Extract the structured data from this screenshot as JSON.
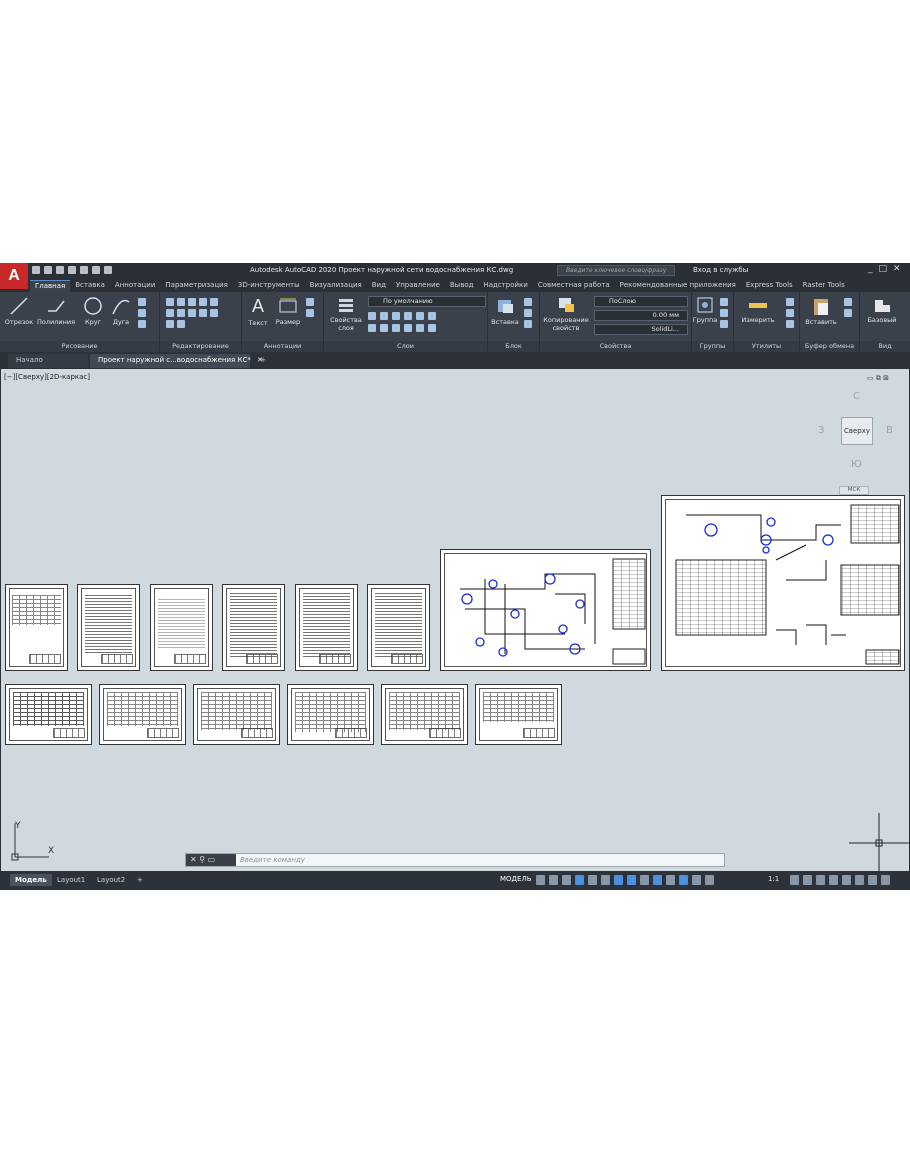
{
  "app": {
    "logo": "A",
    "title": "Autodesk AutoCAD 2020   Проект наружной сети водоснабжения КС.dwg",
    "search_placeholder": "Введите ключевое слово/фразу",
    "signin": "Вход в службы"
  },
  "ribbon_tabs": [
    "Главная",
    "Вставка",
    "Аннотации",
    "Параметризация",
    "3D-инструменты",
    "Визуализация",
    "Вид",
    "Управление",
    "Вывод",
    "Надстройки",
    "Совместная работа",
    "Рекомендованные приложения",
    "Express Tools",
    "Raster Tools"
  ],
  "ribbon": {
    "draw": {
      "title": "Рисование",
      "line": "Отрезок",
      "polyline": "Полилиния",
      "circle": "Круг",
      "arc": "Дуга"
    },
    "modify": {
      "title": "Редактирование"
    },
    "annotation": {
      "title": "Аннотации",
      "text": "Текст",
      "dimension": "Размер"
    },
    "layers": {
      "title": "Слои",
      "layer_props": "Свойства слоя",
      "layer_value": "По умолчанию"
    },
    "block": {
      "title": "Блок",
      "insert": "Вставка"
    },
    "properties": {
      "title": "Свойства",
      "match": "Копирование свойств",
      "color": "ПоСлою",
      "lineweight": "0.00 мм",
      "linetype": "SolidLi..."
    },
    "groups": {
      "title": "Группы",
      "group": "Группа"
    },
    "utilities": {
      "title": "Утилиты",
      "measure": "Измерить"
    },
    "clipboard": {
      "title": "Буфер обмена",
      "paste": "Вставить"
    },
    "view": {
      "title": "Вид",
      "base": "Базовый"
    }
  },
  "file_tabs": {
    "start": "Начало",
    "document": "Проект наружной с...водоснабжения КС*"
  },
  "viewport": {
    "label": "[−][Сверху][2D-каркас]",
    "cube_face": "Сверху",
    "north": "С",
    "south": "Ю",
    "west": "З",
    "east": "В",
    "wcs": "МСК",
    "ucs_x": "X",
    "ucs_y": "Y"
  },
  "command": {
    "placeholder": "Введите команду"
  },
  "status": {
    "model_tab": "Модель",
    "layout1": "Layout1",
    "layout2": "Layout2",
    "model": "МОДЕЛЬ",
    "scale": "1:1"
  }
}
